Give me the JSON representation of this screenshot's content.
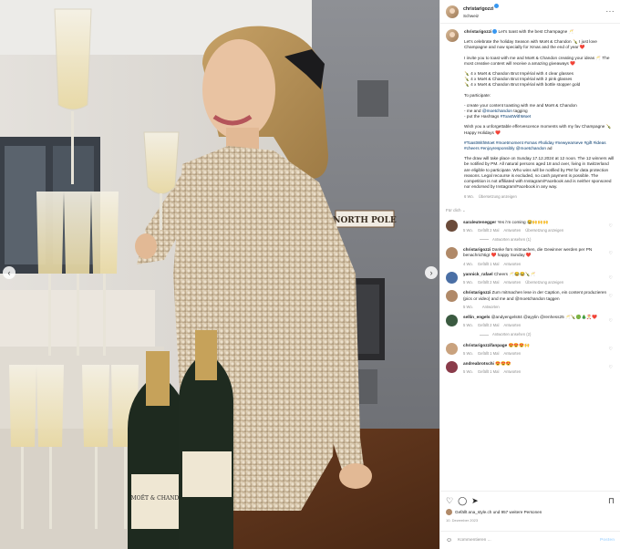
{
  "post": {
    "username": "christarigozzi",
    "location": "Schweiz",
    "more_icon": "more-icon"
  },
  "media": {
    "sign_text": "NORTH POLE",
    "bottle_label": "MOËT & CHANDON",
    "prev_icon": "chevron-left-icon",
    "next_icon": "chevron-right-icon"
  },
  "caption": {
    "username": "christarigozzi",
    "line1": "Let's toast with the best Champagne 🥂",
    "p1": "Let's celebrate the holiday Season with Moët & Chandon 🍾 I just love Champagne and now specially for Xmas and the end of year ❤️",
    "p2": "I invite you to toast with me and Moët & Chandon creating your ideas 🥂 The most creative content will receive a amazing giveaways ❤️",
    "p3a": "🍾 4 x Moët & Chandon Brut Impérial with 4 clear glasses",
    "p3b": "🍾 4 x Moët & Chandon Brut Impérial with 2 pink glasses",
    "p3c": "🍾 4 x Moët & Chandon Brut Impérial with bottle stopper gold",
    "p4": "To participate:",
    "p5a": "- create your content toasting with me and Moët & Chandon",
    "p5b_pre": "- me and ",
    "p5b_link": "@moetchandon",
    "p5b_post": " tagging",
    "p5c_pre": "- put the Hashtags ",
    "p5c_link": "#ToastWithMoet",
    "p6": "Wish you a unforgettable effervescence moments with my fav Champagne 🍾 Happy Holidays ❤️",
    "hashtags": "#ToastWithMoet #moetmoment #xmas #holiday #newyearseve #gift #ideas #cheers #enjoyresponsibly @moetchandon",
    "hashtags_suffix": " ad",
    "p7": "The draw will take place on Sunday 17.12.2024 at 12 noon. The 12 winners will be notified by PM. All natural persons aged 18 and over, living in Switzerland are eligible to participate. Who wins will be notified by PM for data protection reasons. Legal recourse is excluded, no cash payment is possible. The competition is not affiliated with Instagram/Facebook and is neither sponsored nor endorsed by Instagram/Facebook in any way.",
    "time": "6 Wo.",
    "translate": "Übersetzung anzeigen"
  },
  "filter_label": "Für dich ⌄",
  "comments": [
    {
      "user": "saraleutenegger",
      "text": "Yes i'm coming 😂🙌🙌🙌",
      "time": "5 Wo.",
      "likes": "Gefällt 2 Mal",
      "reply": "Antworten",
      "translate": "Übersetzung anzeigen",
      "replies": "Antworten ansehen (1)",
      "color": "#6b4b3a"
    },
    {
      "user": "christarigozzi",
      "text": "Danke fürs mitmachen, die Gewinner werden per PN benachrichtigt ❤️ happy Sunday ❤️",
      "time": "4 Wo.",
      "likes": "Gefällt 1 Mal",
      "reply": "Antworten",
      "translate": "",
      "replies": "",
      "color": "#b08968"
    },
    {
      "user": "yannick_rafael",
      "text": "Cheers 🥂😂😂🍾🥂",
      "time": "5 Wo.",
      "likes": "Gefällt 2 Mal",
      "reply": "Antworten",
      "translate": "Übersetzung anzeigen",
      "replies": "",
      "color": "#4a6fa5"
    },
    {
      "user": "christarigozzi",
      "text": "Zum mitmachen lese in der Caption, ein content produzieren (pics or video) and me and @moetchandon taggen",
      "time": "5 Wo.",
      "likes": "",
      "reply": "Antworten",
      "translate": "",
      "replies": "",
      "color": "#b08968"
    },
    {
      "user": "sellin_engels",
      "text": "@andyengels84 @ayylin @renhess25 🥂🍾🟢🎄🎅❤️",
      "time": "5 Wo.",
      "likes": "Gefällt 2 Mal",
      "reply": "Antworten",
      "translate": "",
      "replies": "Antworten ansehen (2)",
      "color": "#3a5a40"
    },
    {
      "user": "christarigozzifanpage",
      "text": "😍😍😍🙌",
      "time": "5 Wo.",
      "likes": "Gefällt 1 Mal",
      "reply": "Antworten",
      "translate": "",
      "replies": "",
      "color": "#c9a27e"
    },
    {
      "user": "andreabrotschi",
      "text": "😍😍😍",
      "time": "5 Wo.",
      "likes": "Gefällt 1 Mal",
      "reply": "Antworten",
      "translate": "",
      "replies": "",
      "color": "#8a3b4a"
    }
  ],
  "footer": {
    "likes_text": "Gefällt ana_style.ch und 957 weitere Personen",
    "date": "10. Dezember 2023",
    "comment_placeholder": "Kommentieren ...",
    "post_label": "Posten"
  }
}
